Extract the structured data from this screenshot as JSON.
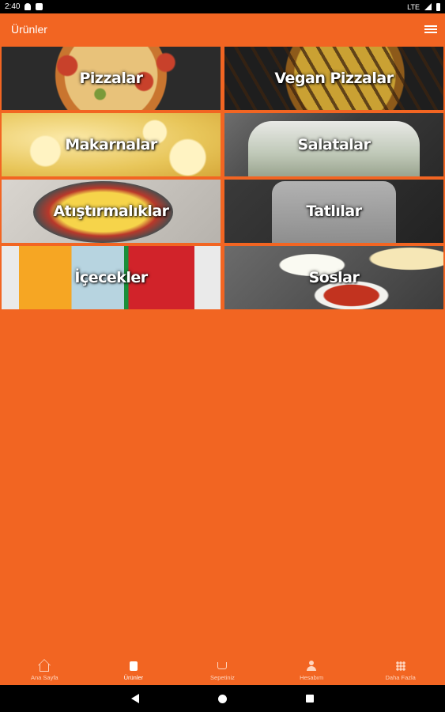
{
  "status_bar": {
    "time": "2:40",
    "network": "LTE"
  },
  "app_bar": {
    "title": "Ürünler",
    "menu_icon": "list-icon"
  },
  "categories": [
    {
      "label": "Pizzalar"
    },
    {
      "label": "Vegan Pizzalar"
    },
    {
      "label": "Makarnalar"
    },
    {
      "label": "Salatalar"
    },
    {
      "label": "Atıştırmalıklar"
    },
    {
      "label": "Tatlılar"
    },
    {
      "label": "İçecekler"
    },
    {
      "label": "Soslar"
    }
  ],
  "bottom_nav": {
    "items": [
      {
        "label": "Ana Sayfa",
        "icon": "home-icon",
        "active": false
      },
      {
        "label": "Ürünler",
        "icon": "menu-book-icon",
        "active": true
      },
      {
        "label": "Sepetiniz",
        "icon": "cart-icon",
        "active": false
      },
      {
        "label": "Hesabım",
        "icon": "account-icon",
        "active": false
      },
      {
        "label": "Daha Fazla",
        "icon": "apps-icon",
        "active": false
      }
    ]
  },
  "colors": {
    "brand": "#f26522"
  }
}
